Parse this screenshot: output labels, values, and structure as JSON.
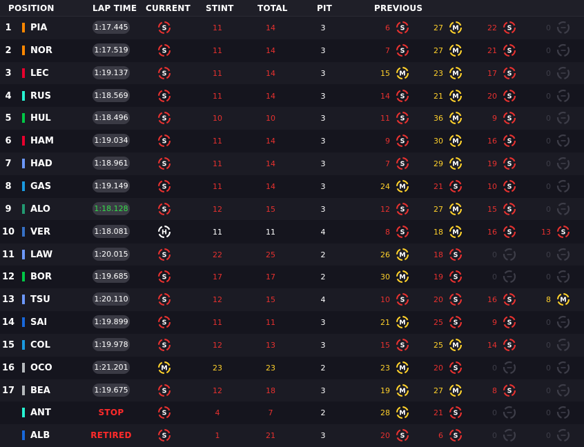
{
  "header": {
    "position": "POSITION",
    "lap_time": "LAP TIME",
    "current": "CURRENT",
    "stint": "STINT",
    "total": "TOTAL",
    "pit": "PIT",
    "previous": "PREVIOUS"
  },
  "colors": {
    "soft": "#e8312f",
    "medium": "#ffd12b",
    "hard": "#ffffff",
    "none": "#3d3d48",
    "fastest_lap": "#35e04a",
    "status": "#ff2a2a"
  },
  "rows": [
    {
      "pos": "1",
      "team_color": "#ff8700",
      "driver": "PIA",
      "lap": "1:17.445",
      "current": "S",
      "current_letter": "S",
      "stint": "11",
      "total": "14",
      "pit": "3",
      "prev": [
        {
          "laps": "6",
          "tyre": "S"
        },
        {
          "laps": "27",
          "tyre": "M"
        },
        {
          "laps": "22",
          "tyre": "S"
        },
        {
          "laps": "0",
          "tyre": "none"
        }
      ]
    },
    {
      "pos": "2",
      "team_color": "#ff8700",
      "driver": "NOR",
      "lap": "1:17.519",
      "current": "S",
      "current_letter": "S",
      "stint": "11",
      "total": "14",
      "pit": "3",
      "prev": [
        {
          "laps": "7",
          "tyre": "S"
        },
        {
          "laps": "27",
          "tyre": "M"
        },
        {
          "laps": "21",
          "tyre": "S"
        },
        {
          "laps": "0",
          "tyre": "none"
        }
      ]
    },
    {
      "pos": "3",
      "team_color": "#e8002d",
      "driver": "LEC",
      "lap": "1:19.137",
      "current": "S",
      "current_letter": "S",
      "stint": "11",
      "total": "14",
      "pit": "3",
      "prev": [
        {
          "laps": "15",
          "tyre": "M"
        },
        {
          "laps": "23",
          "tyre": "M"
        },
        {
          "laps": "17",
          "tyre": "S"
        },
        {
          "laps": "0",
          "tyre": "none"
        }
      ]
    },
    {
      "pos": "4",
      "team_color": "#27f4d2",
      "driver": "RUS",
      "lap": "1:18.569",
      "current": "S",
      "current_letter": "S",
      "stint": "11",
      "total": "14",
      "pit": "3",
      "prev": [
        {
          "laps": "14",
          "tyre": "S"
        },
        {
          "laps": "21",
          "tyre": "M"
        },
        {
          "laps": "20",
          "tyre": "S"
        },
        {
          "laps": "0",
          "tyre": "none"
        }
      ]
    },
    {
      "pos": "5",
      "team_color": "#00c846",
      "driver": "HUL",
      "lap": "1:18.496",
      "current": "S",
      "current_letter": "S",
      "stint": "10",
      "total": "10",
      "pit": "3",
      "prev": [
        {
          "laps": "11",
          "tyre": "S"
        },
        {
          "laps": "36",
          "tyre": "M"
        },
        {
          "laps": "9",
          "tyre": "S"
        },
        {
          "laps": "0",
          "tyre": "none"
        }
      ]
    },
    {
      "pos": "6",
      "team_color": "#e8002d",
      "driver": "HAM",
      "lap": "1:19.034",
      "current": "S",
      "current_letter": "S",
      "stint": "11",
      "total": "14",
      "pit": "3",
      "prev": [
        {
          "laps": "9",
          "tyre": "S"
        },
        {
          "laps": "30",
          "tyre": "M"
        },
        {
          "laps": "16",
          "tyre": "S"
        },
        {
          "laps": "0",
          "tyre": "none"
        }
      ]
    },
    {
      "pos": "7",
      "team_color": "#6c98ff",
      "driver": "HAD",
      "lap": "1:18.961",
      "current": "S",
      "current_letter": "S",
      "stint": "11",
      "total": "14",
      "pit": "3",
      "prev": [
        {
          "laps": "7",
          "tyre": "S"
        },
        {
          "laps": "29",
          "tyre": "M"
        },
        {
          "laps": "19",
          "tyre": "S"
        },
        {
          "laps": "0",
          "tyre": "none"
        }
      ]
    },
    {
      "pos": "8",
      "team_color": "#1a9ae0",
      "driver": "GAS",
      "lap": "1:19.149",
      "current": "S",
      "current_letter": "S",
      "stint": "11",
      "total": "14",
      "pit": "3",
      "prev": [
        {
          "laps": "24",
          "tyre": "M"
        },
        {
          "laps": "21",
          "tyre": "S"
        },
        {
          "laps": "10",
          "tyre": "S"
        },
        {
          "laps": "0",
          "tyre": "none"
        }
      ]
    },
    {
      "pos": "9",
      "team_color": "#229971",
      "driver": "ALO",
      "lap": "1:18.128",
      "lap_fast": true,
      "current": "S",
      "current_letter": "S",
      "stint": "12",
      "total": "15",
      "pit": "3",
      "prev": [
        {
          "laps": "12",
          "tyre": "S"
        },
        {
          "laps": "27",
          "tyre": "M"
        },
        {
          "laps": "15",
          "tyre": "S"
        },
        {
          "laps": "0",
          "tyre": "none"
        }
      ]
    },
    {
      "pos": "10",
      "team_color": "#3671c6",
      "driver": "VER",
      "lap": "1:18.081",
      "current": "H",
      "current_letter": "H",
      "stint": "11",
      "total": "11",
      "pit": "4",
      "prev": [
        {
          "laps": "8",
          "tyre": "S"
        },
        {
          "laps": "18",
          "tyre": "M"
        },
        {
          "laps": "16",
          "tyre": "S"
        },
        {
          "laps": "13",
          "tyre": "S"
        }
      ]
    },
    {
      "pos": "11",
      "team_color": "#6c98ff",
      "driver": "LAW",
      "lap": "1:20.015",
      "current": "S",
      "current_letter": "S",
      "stint": "22",
      "total": "25",
      "pit": "2",
      "prev": [
        {
          "laps": "26",
          "tyre": "M"
        },
        {
          "laps": "18",
          "tyre": "S"
        },
        {
          "laps": "0",
          "tyre": "none"
        },
        {
          "laps": "0",
          "tyre": "none"
        }
      ]
    },
    {
      "pos": "12",
      "team_color": "#00c846",
      "driver": "BOR",
      "lap": "1:19.685",
      "current": "S",
      "current_letter": "S",
      "stint": "17",
      "total": "17",
      "pit": "2",
      "prev": [
        {
          "laps": "30",
          "tyre": "M"
        },
        {
          "laps": "19",
          "tyre": "S"
        },
        {
          "laps": "0",
          "tyre": "none"
        },
        {
          "laps": "0",
          "tyre": "none"
        }
      ]
    },
    {
      "pos": "13",
      "team_color": "#6c98ff",
      "driver": "TSU",
      "lap": "1:20.110",
      "current": "S",
      "current_letter": "S",
      "stint": "12",
      "total": "15",
      "pit": "4",
      "prev": [
        {
          "laps": "10",
          "tyre": "S"
        },
        {
          "laps": "20",
          "tyre": "S"
        },
        {
          "laps": "16",
          "tyre": "S"
        },
        {
          "laps": "8",
          "tyre": "M"
        }
      ]
    },
    {
      "pos": "14",
      "team_color": "#1868db",
      "driver": "SAI",
      "lap": "1:19.899",
      "current": "S",
      "current_letter": "S",
      "stint": "11",
      "total": "11",
      "pit": "3",
      "prev": [
        {
          "laps": "21",
          "tyre": "M"
        },
        {
          "laps": "25",
          "tyre": "S"
        },
        {
          "laps": "9",
          "tyre": "S"
        },
        {
          "laps": "0",
          "tyre": "none"
        }
      ]
    },
    {
      "pos": "15",
      "team_color": "#1a9ae0",
      "driver": "COL",
      "lap": "1:19.978",
      "current": "S",
      "current_letter": "S",
      "stint": "12",
      "total": "13",
      "pit": "3",
      "prev": [
        {
          "laps": "15",
          "tyre": "S"
        },
        {
          "laps": "25",
          "tyre": "M"
        },
        {
          "laps": "14",
          "tyre": "S"
        },
        {
          "laps": "0",
          "tyre": "none"
        }
      ]
    },
    {
      "pos": "16",
      "team_color": "#b6babd",
      "driver": "OCO",
      "lap": "1:21.201",
      "current": "M",
      "current_letter": "M",
      "stint": "23",
      "total": "23",
      "pit": "2",
      "prev": [
        {
          "laps": "23",
          "tyre": "M"
        },
        {
          "laps": "20",
          "tyre": "S"
        },
        {
          "laps": "0",
          "tyre": "none"
        },
        {
          "laps": "0",
          "tyre": "none"
        }
      ]
    },
    {
      "pos": "17",
      "team_color": "#b6babd",
      "driver": "BEA",
      "lap": "1:19.675",
      "current": "S",
      "current_letter": "S",
      "stint": "12",
      "total": "18",
      "pit": "3",
      "prev": [
        {
          "laps": "19",
          "tyre": "M"
        },
        {
          "laps": "27",
          "tyre": "M"
        },
        {
          "laps": "8",
          "tyre": "S"
        },
        {
          "laps": "0",
          "tyre": "none"
        }
      ]
    },
    {
      "pos": "",
      "team_color": "#27f4d2",
      "driver": "ANT",
      "status": "STOP",
      "current": "S",
      "current_letter": "S",
      "stint": "4",
      "total": "7",
      "pit": "2",
      "prev": [
        {
          "laps": "28",
          "tyre": "M"
        },
        {
          "laps": "21",
          "tyre": "S"
        },
        {
          "laps": "0",
          "tyre": "none"
        },
        {
          "laps": "0",
          "tyre": "none"
        }
      ]
    },
    {
      "pos": "",
      "team_color": "#1868db",
      "driver": "ALB",
      "status": "RETIRED",
      "current": "S",
      "current_letter": "S",
      "stint": "1",
      "total": "21",
      "pit": "3",
      "prev": [
        {
          "laps": "20",
          "tyre": "S"
        },
        {
          "laps": "6",
          "tyre": "S"
        },
        {
          "laps": "0",
          "tyre": "none"
        },
        {
          "laps": "0",
          "tyre": "none"
        }
      ]
    }
  ]
}
